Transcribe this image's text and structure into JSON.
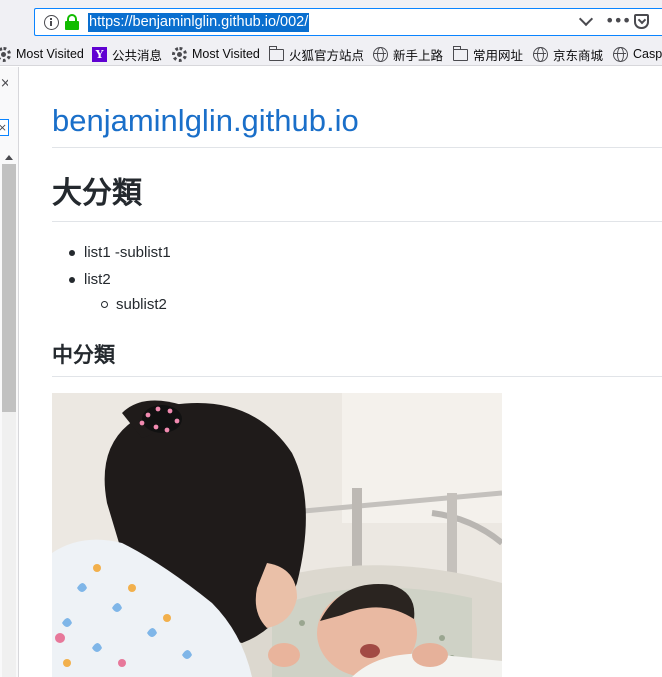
{
  "browser": {
    "url": "https://benjaminlglin.github.io/002/",
    "more_label": "•••"
  },
  "bookmarks": [
    {
      "label": "Most Visited",
      "icon": "gear-icon"
    },
    {
      "label": "公共消息",
      "icon": "yahoo-icon",
      "glyph": "Y"
    },
    {
      "label": "Most Visited",
      "icon": "gear-icon"
    },
    {
      "label": "火狐官方站点",
      "icon": "folder-icon"
    },
    {
      "label": "新手上路",
      "icon": "globe-icon"
    },
    {
      "label": "常用网址",
      "icon": "folder-icon"
    },
    {
      "label": "京东商城",
      "icon": "globe-icon"
    },
    {
      "label": "Casp",
      "icon": "globe-icon"
    }
  ],
  "sidebar": {
    "close_glyph": "×",
    "box_glyph": "×"
  },
  "page": {
    "site_title": "benjaminlglin.github.io",
    "heading1": "大分類",
    "list": [
      {
        "label": "list1 -sublist1"
      },
      {
        "label": "list2",
        "children": [
          {
            "label": "sublist2"
          }
        ]
      }
    ],
    "heading2": "中分類",
    "image": {
      "subject": "photo of a young girl looking at a crying newborn baby in a hospital bassinet"
    }
  }
}
